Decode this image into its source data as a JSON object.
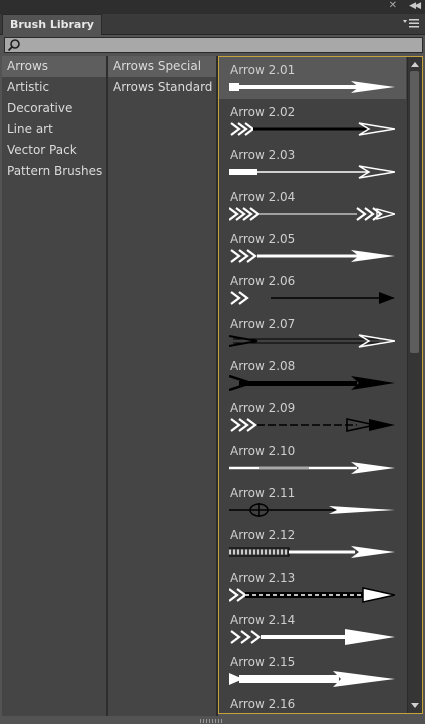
{
  "panel": {
    "tab_label": "Brush Library"
  },
  "search": {
    "placeholder": "",
    "value": ""
  },
  "categories": [
    "Arrows",
    "Artistic",
    "Decorative",
    "Line art",
    "Vector Pack",
    "Pattern Brushes"
  ],
  "categories_selected": 0,
  "subcategories": [
    "Arrows Special",
    "Arrows Standard"
  ],
  "subcategories_selected": 0,
  "brushes": [
    "Arrow 2.01",
    "Arrow 2.02",
    "Arrow 2.03",
    "Arrow 2.04",
    "Arrow 2.05",
    "Arrow 2.06",
    "Arrow 2.07",
    "Arrow 2.08",
    "Arrow 2.09",
    "Arrow 2.10",
    "Arrow 2.11",
    "Arrow 2.12",
    "Arrow 2.13",
    "Arrow 2.14",
    "Arrow 2.15",
    "Arrow 2.16"
  ],
  "brushes_selected": 0,
  "colors": {
    "accent_border": "#c6a33a",
    "brush_stroke": "#ffffff"
  }
}
